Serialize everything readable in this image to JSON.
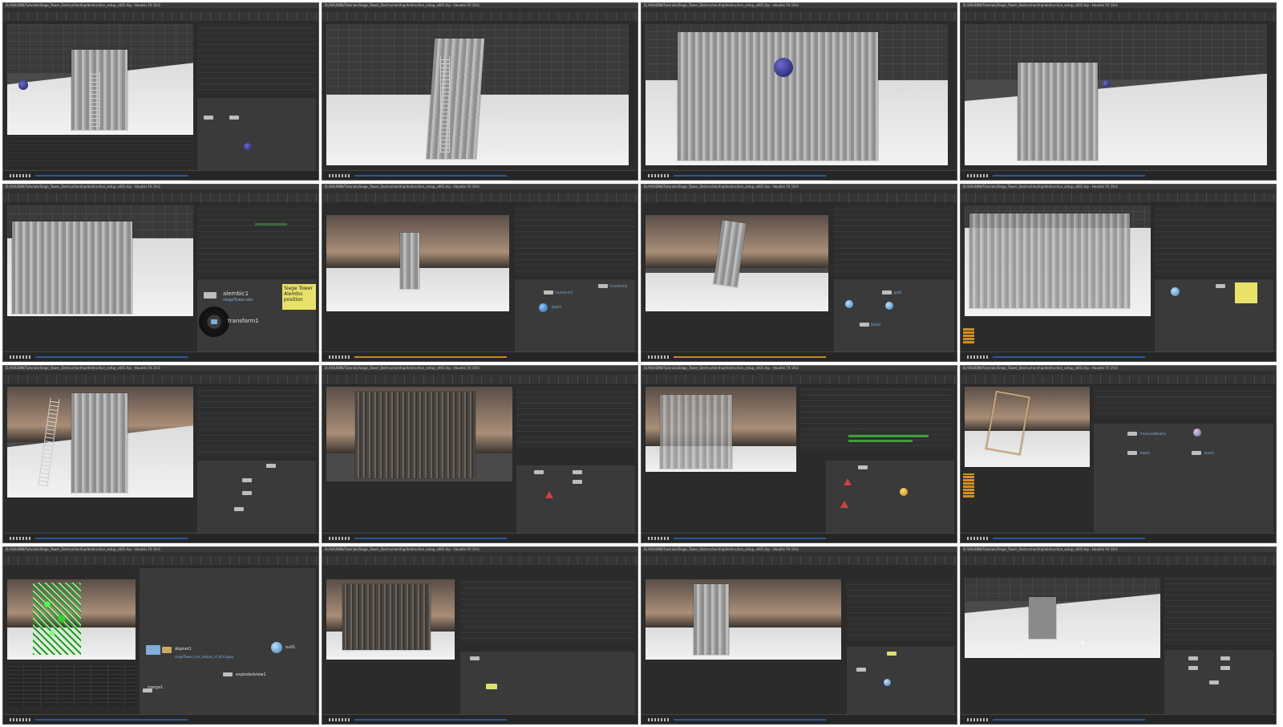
{
  "thumbnails": [
    {
      "id": "t1",
      "title": "D:/HOUDINI/Tutorials/Siege_Tower_Destruction/hip/destruction_setup_v001.hip - Houdini FX 19.0"
    },
    {
      "id": "t2",
      "title": "D:/HOUDINI/Tutorials/Siege_Tower_Destruction/hip/destruction_setup_v001.hip - Houdini FX 19.0"
    },
    {
      "id": "t3",
      "title": "D:/HOUDINI/Tutorials/Siege_Tower_Destruction/hip/destruction_setup_v001.hip - Houdini FX 19.0"
    },
    {
      "id": "t4",
      "title": "D:/HOUDINI/Tutorials/Siege_Tower_Destruction/hip/destruction_setup_v001.hip - Houdini FX 19.0"
    },
    {
      "id": "t5",
      "title": "D:/HOUDINI/Tutorials/Siege_Tower_Destruction/hip/destruction_setup_v001.hip - Houdini FX 19.0",
      "nodes": {
        "alembic": "alembic1",
        "alembic_path": "siegeTower.abc",
        "transform": "transform1"
      },
      "sticky_note": "Siege Tower Alembic position"
    },
    {
      "id": "t6",
      "title": "D:/HOUDINI/Tutorials/Siege_Tower_Destruction/hip/destruction_setup_v001.hip - Houdini FX 19.0",
      "nodes": {
        "a": "transform1",
        "b": "blast1",
        "c": "transform2"
      }
    },
    {
      "id": "t7",
      "title": "D:/HOUDINI/Tutorials/Siege_Tower_Destruction/hip/destruction_setup_v001.hip - Houdini FX 19.0",
      "nodes": {
        "a": "split1",
        "b": "blast2"
      }
    },
    {
      "id": "t8",
      "title": "D:/HOUDINI/Tutorials/Siege_Tower_Destruction/hip/destruction_setup_v001.hip - Houdini FX 19.0"
    },
    {
      "id": "t9",
      "title": "D:/HOUDINI/Tutorials/Siege_Tower_Destruction/hip/destruction_setup_v001.hip - Houdini FX 19.0"
    },
    {
      "id": "t10",
      "title": "D:/HOUDINI/Tutorials/Siege_Tower_Destruction/hip/destruction_setup_v001.hip - Houdini FX 19.0"
    },
    {
      "id": "t11",
      "title": "D:/HOUDINI/Tutorials/Siege_Tower_Destruction/hip/destruction_setup_v001.hip - Houdini FX 19.0"
    },
    {
      "id": "t12",
      "title": "D:/HOUDINI/Tutorials/Siege_Tower_Destruction/hip/destruction_setup_v001.hip - Houdini FX 19.0",
      "nodes": {
        "a": "fracturedBeams",
        "b": "blast1",
        "c": "blast2"
      }
    },
    {
      "id": "t13",
      "title": "D:/HOUDINI/Tutorials/Siege_Tower_Destruction/hip/destruction_setup_v001.hip - Houdini FX 19.0",
      "nodes": {
        "dopnet": "dopnet1",
        "dop_path": "siegeTower_sim_rbdout_v1.$F4.bgeo",
        "null": "null1",
        "explode": "explodedview1",
        "merge": "merge1"
      }
    },
    {
      "id": "t14",
      "title": "D:/HOUDINI/Tutorials/Siege_Tower_Destruction/hip/destruction_setup_v001.hip - Houdini FX 19.0"
    },
    {
      "id": "t15",
      "title": "D:/HOUDINI/Tutorials/Siege_Tower_Destruction/hip/destruction_setup_v001.hip - Houdini FX 19.0"
    },
    {
      "id": "t16",
      "title": "D:/HOUDINI/Tutorials/Siege_Tower_Destruction/hip/destruction_setup_v001.hip - Houdini FX 19.0"
    }
  ],
  "colors": {
    "ui_dark": "#2b2b2b",
    "ground": "#eeeeee",
    "timeline_blue": "#2a5a9a",
    "timeline_orange": "#c88a20",
    "node_label": "#7fb0e0",
    "sticky": "#e8e26a",
    "warning": "#d04040",
    "rbd_green": "#3aa03a"
  },
  "icons": [
    "sphere-icon",
    "warning-icon",
    "radial-menu-icon",
    "cursor-icon"
  ]
}
